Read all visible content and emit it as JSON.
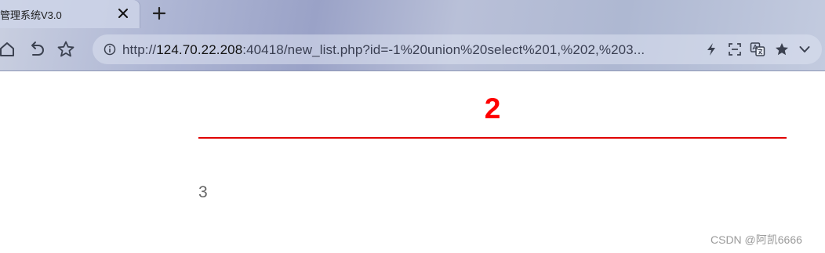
{
  "tab": {
    "title": "管理系统V3.0",
    "close_icon": "close-icon",
    "new_tab_icon": "plus-icon"
  },
  "toolbar": {
    "home_icon": "home-icon",
    "back_icon": "undo-icon",
    "bookmark_icon": "star-icon"
  },
  "address_bar": {
    "scheme": "http://",
    "host": "124.70.22.208",
    "rest": ":40418/new_list.php?id=-1%20union%20select%201,%202,%203...",
    "icons": [
      "info-icon",
      "lightning-icon",
      "screenshot-icon",
      "translate-icon",
      "star-icon",
      "chevron-down-icon"
    ]
  },
  "article": {
    "title": "2",
    "body": "3"
  },
  "watermark": "CSDN @阿凯6666",
  "colors": {
    "title": "#ff0000",
    "rule": "#e00000",
    "body_text": "#666666"
  }
}
